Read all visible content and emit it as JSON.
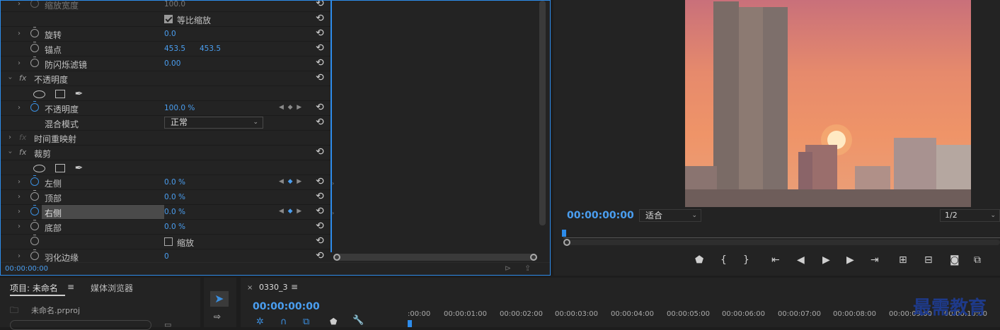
{
  "effect_controls": {
    "rows": [
      {
        "label": "缩放宽度",
        "value": "100.0"
      },
      {
        "check_label": "等比缩放"
      },
      {
        "label": "旋转",
        "value": "0.0"
      },
      {
        "label": "锚点",
        "value": "453.5",
        "value2": "453.5"
      },
      {
        "label": "防闪烁滤镜",
        "value": "0.00"
      },
      {
        "section": "不透明度",
        "fx": "fx"
      },
      {
        "label": "不透明度",
        "value": "100.0 %"
      },
      {
        "label": "混合模式",
        "dropdown": "正常"
      },
      {
        "section": "时间重映射",
        "fx": "fx"
      },
      {
        "section": "裁剪",
        "fx": "fx"
      },
      {
        "label": "左侧",
        "value": "0.0 %"
      },
      {
        "label": "顶部",
        "value": "0.0 %"
      },
      {
        "label": "右侧",
        "value": "0.0 %"
      },
      {
        "label": "底部",
        "value": "0.0 %"
      },
      {
        "check_label": "缩放"
      },
      {
        "label": "羽化边缘",
        "value": "0"
      }
    ],
    "timecode": "00:00:00:00"
  },
  "program": {
    "timecode": "00:00:00:00",
    "fit": "适合",
    "resolution": "1/2"
  },
  "project": {
    "tab1": "项目: 未命名",
    "tab2": "媒体浏览器",
    "file": "未命名.prproj"
  },
  "timeline": {
    "tab": "0330_3",
    "timecode": "00:00:00:00",
    "ticks": [
      ":00:00",
      "00:00:01:00",
      "00:00:02:00",
      "00:00:03:00",
      "00:00:04:00",
      "00:00:05:00",
      "00:00:06:00",
      "00:00:07:00",
      "00:00:08:00",
      "00:00:09:00",
      "00:00:10:00"
    ]
  },
  "watermark": "最需教育",
  "colors": {
    "accent": "#2d8ceb",
    "value": "#4a9ef0"
  }
}
